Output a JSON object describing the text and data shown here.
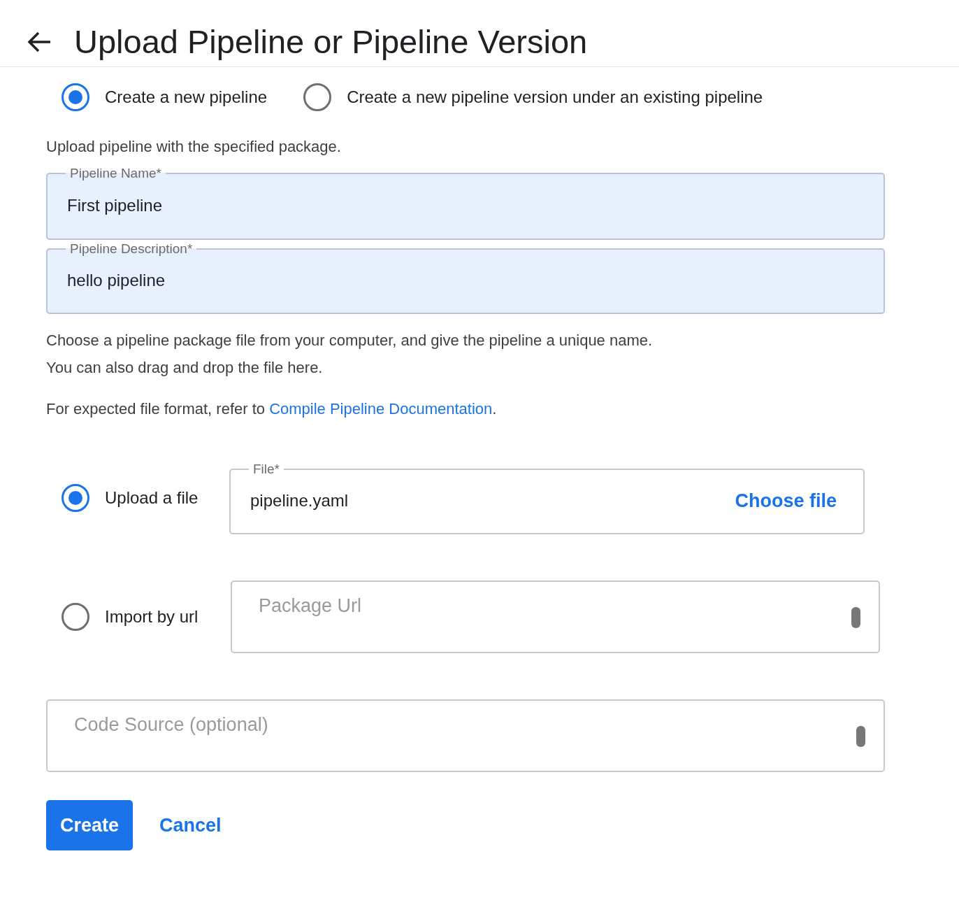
{
  "header": {
    "title": "Upload Pipeline or Pipeline Version"
  },
  "mode_options": [
    {
      "label": "Create a new pipeline",
      "selected": true
    },
    {
      "label": "Create a new pipeline version under an existing pipeline",
      "selected": false
    }
  ],
  "intro": "Upload pipeline with the specified package.",
  "fields": [
    {
      "label": "Pipeline Name*",
      "value": "First pipeline",
      "autofilled": true
    },
    {
      "label": "Pipeline Description*",
      "value": "hello pipeline",
      "autofilled": true
    }
  ],
  "instructions": [
    "Choose a pipeline package file from your computer, and give the pipeline a unique name.",
    "You can also drag and drop the file here."
  ],
  "format_note": {
    "text": "For expected file format, refer to ",
    "link": "Compile Pipeline Documentation",
    "suffix": "."
  },
  "source_options": [
    {
      "kind": "file",
      "label": "Upload a file",
      "selected": true,
      "field_label": "File*",
      "value": "pipeline.yaml",
      "action": "Choose file"
    },
    {
      "kind": "url",
      "label": "Import by url",
      "selected": false,
      "placeholder": "Package Url"
    }
  ],
  "code_source": {
    "placeholder": "Code Source (optional)"
  },
  "buttons": [
    {
      "kind": "primary",
      "label": "Create"
    },
    {
      "kind": "text",
      "label": "Cancel"
    }
  ]
}
